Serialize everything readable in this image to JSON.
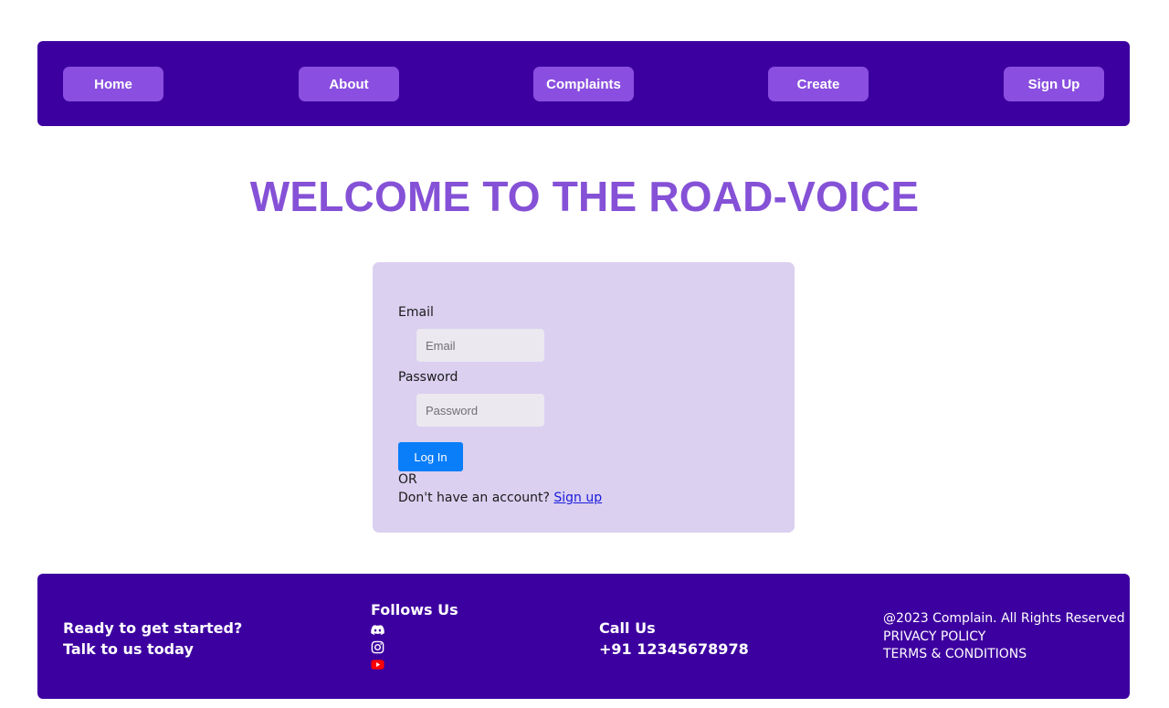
{
  "nav": {
    "items": [
      {
        "label": "Home"
      },
      {
        "label": "About"
      },
      {
        "label": "Complaints"
      },
      {
        "label": "Create"
      },
      {
        "label": "Sign Up"
      }
    ]
  },
  "hero": {
    "title": "WELCOME TO THE ROAD-VOICE"
  },
  "login": {
    "email_label": "Email",
    "email_placeholder": "Email",
    "email_value": "",
    "password_label": "Password",
    "password_placeholder": "Password",
    "password_value": "",
    "login_button": "Log In",
    "or_text": "OR",
    "no_account_text": "Don't have an account?",
    "signup_link": "Sign up"
  },
  "footer": {
    "cta_line1": "Ready to get started?",
    "cta_line2": "Talk to us today",
    "follow_title": "Follows Us",
    "social_icons": [
      "discord-icon",
      "instagram-icon",
      "youtube-icon"
    ],
    "call_title": "Call Us",
    "phone": "+91 12345678978",
    "copyright": "@2023 Complain. All Rights Reserved",
    "privacy": "PRIVACY POLICY",
    "terms": "TERMS & CONDITIONS"
  },
  "colors": {
    "nav_bg": "#3d00a0",
    "nav_button": "#8a4fe0",
    "title": "#8551d6",
    "card_bg": "#dbd0f0",
    "primary_button": "#0a7df8",
    "youtube_red": "#ff0000"
  }
}
